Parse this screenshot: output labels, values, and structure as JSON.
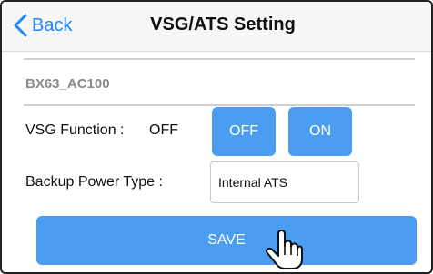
{
  "navbar": {
    "back_label": "Back",
    "title": "VSG/ATS Setting"
  },
  "device": {
    "name": "BX63_AC100"
  },
  "vsg": {
    "label": "VSG Function :",
    "status": "OFF",
    "off_label": "OFF",
    "on_label": "ON"
  },
  "backup": {
    "label": "Backup Power Type :",
    "value": "Internal ATS"
  },
  "save_label": "SAVE",
  "colors": {
    "accent": "#1e86f7",
    "button": "#4a9df0"
  },
  "icons": {
    "back": "chevron-left-icon",
    "cursor": "hand-pointer-icon"
  }
}
